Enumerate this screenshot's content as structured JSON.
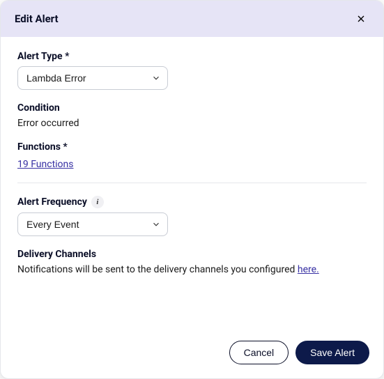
{
  "dialog": {
    "title": "Edit Alert"
  },
  "alertType": {
    "label": "Alert Type *",
    "value": "Lambda Error"
  },
  "condition": {
    "label": "Condition",
    "value": "Error occurred"
  },
  "functions": {
    "label": "Functions *",
    "linkText": "19 Functions"
  },
  "alertFrequency": {
    "label": "Alert Frequency",
    "value": "Every Event"
  },
  "deliveryChannels": {
    "label": "Delivery Channels",
    "prefixText": "Notifications will be sent to the delivery channels you configured ",
    "linkText": "here."
  },
  "buttons": {
    "cancel": "Cancel",
    "save": "Save Alert"
  }
}
